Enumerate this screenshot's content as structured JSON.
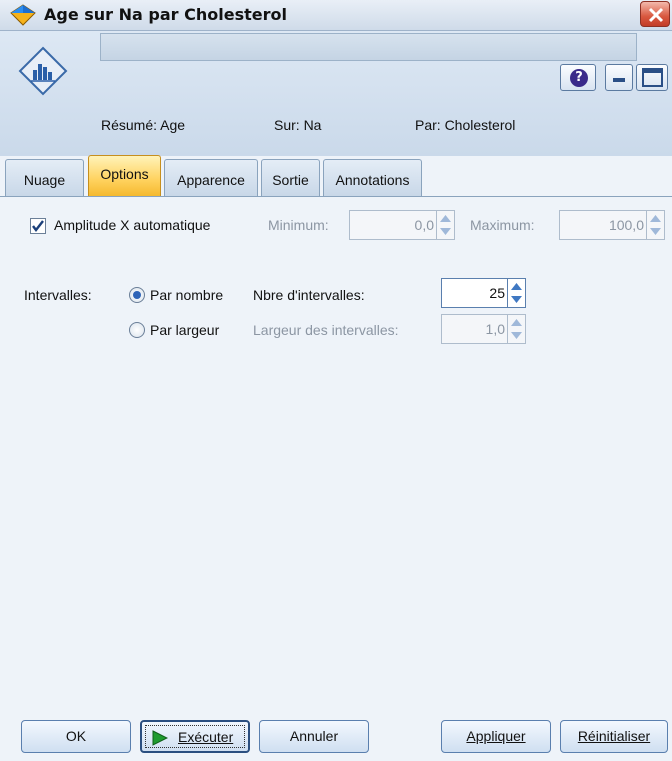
{
  "window": {
    "title": "Age sur Na par Cholesterol",
    "title_icon": "diamond-node-icon",
    "close_icon": "close-icon"
  },
  "header": {
    "node_icon": "histogram-node-icon",
    "node_name_value": "",
    "help_icon": "help-icon",
    "minimize_icon": "minimize-icon",
    "maximize_icon": "maximize-icon",
    "summary_label": "Résumé: Age",
    "over_label": "Sur: Na",
    "by_label": "Par: Cholesterol"
  },
  "tabs": [
    {
      "label": "Nuage",
      "active": false
    },
    {
      "label": "Options",
      "active": true
    },
    {
      "label": "Apparence",
      "active": false
    },
    {
      "label": "Sortie",
      "active": false
    },
    {
      "label": "Annotations",
      "active": false
    }
  ],
  "options": {
    "auto_x_range": {
      "label": "Amplitude X automatique",
      "checked": true
    },
    "minimum": {
      "label": "Minimum:",
      "value": "0,0",
      "enabled": false
    },
    "maximum": {
      "label": "Maximum:",
      "value": "100,0",
      "enabled": false
    },
    "intervals_label": "Intervalles:",
    "by_number": {
      "label": "Par nombre",
      "selected": true
    },
    "number_of_intervals": {
      "label": "Nbre d'intervalles:",
      "value": "25",
      "enabled": true
    },
    "by_width": {
      "label": "Par largeur",
      "selected": false
    },
    "interval_width": {
      "label": "Largeur des intervalles:",
      "value": "1,0",
      "enabled": false
    }
  },
  "buttons": {
    "ok": "OK",
    "execute": "Exécuter",
    "cancel": "Annuler",
    "apply": "Appliquer",
    "reset": "Réinitialiser"
  },
  "colors": {
    "active_tab": "#ffd25e",
    "accent_blue": "#2e64b8",
    "execute_green": "#1f9b2f"
  }
}
